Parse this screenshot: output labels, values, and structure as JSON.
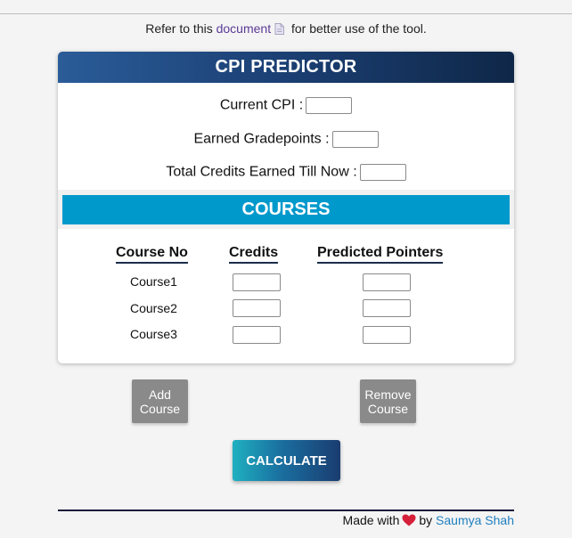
{
  "refer": {
    "prefix": "Refer to this",
    "link_text": "document",
    "suffix": "for better use of the tool."
  },
  "card": {
    "title": "CPI PREDICTOR",
    "fields": [
      {
        "label": "Current CPI :",
        "value": ""
      },
      {
        "label": "Earned Gradepoints :",
        "value": ""
      },
      {
        "label": "Total Credits Earned Till Now :",
        "value": ""
      }
    ],
    "courses_title": "COURSES",
    "columns": [
      "Course No",
      "Credits",
      "Predicted Pointers"
    ],
    "courses": [
      {
        "name": "Course1",
        "credits": "",
        "pointers": ""
      },
      {
        "name": "Course2",
        "credits": "",
        "pointers": ""
      },
      {
        "name": "Course3",
        "credits": "",
        "pointers": ""
      }
    ]
  },
  "buttons": {
    "add": [
      "Add",
      "Course"
    ],
    "remove": [
      "Remove",
      "Course"
    ],
    "calculate": "CALCULATE"
  },
  "footer": {
    "made_with": "Made with",
    "by": "by",
    "author": "Saumya Shah"
  },
  "colors": {
    "header_gradient": [
      "#2a5c98",
      "#0f2748"
    ],
    "courses_bar": "#0099cc",
    "gray_button": "#8a8a8a",
    "link": "#5b3a97",
    "author_link": "#1f7fbf",
    "heart": "#d6203a"
  },
  "icons": {
    "document": "document-icon",
    "heart": "heart-icon"
  }
}
